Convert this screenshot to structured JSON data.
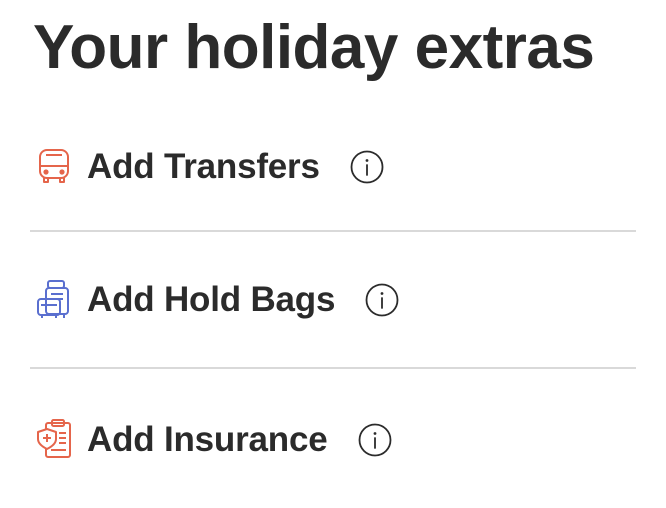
{
  "header": {
    "title": "Your holiday extras"
  },
  "extras": [
    {
      "label": "Add Transfers",
      "icon": "bus-icon",
      "icon_color": "#e5654b"
    },
    {
      "label": "Add Hold Bags",
      "icon": "luggage-icon",
      "icon_color": "#5a6fcf"
    },
    {
      "label": "Add Insurance",
      "icon": "insurance-clipboard-icon",
      "icon_color": "#e5654b"
    }
  ],
  "info_icon": "info-icon"
}
